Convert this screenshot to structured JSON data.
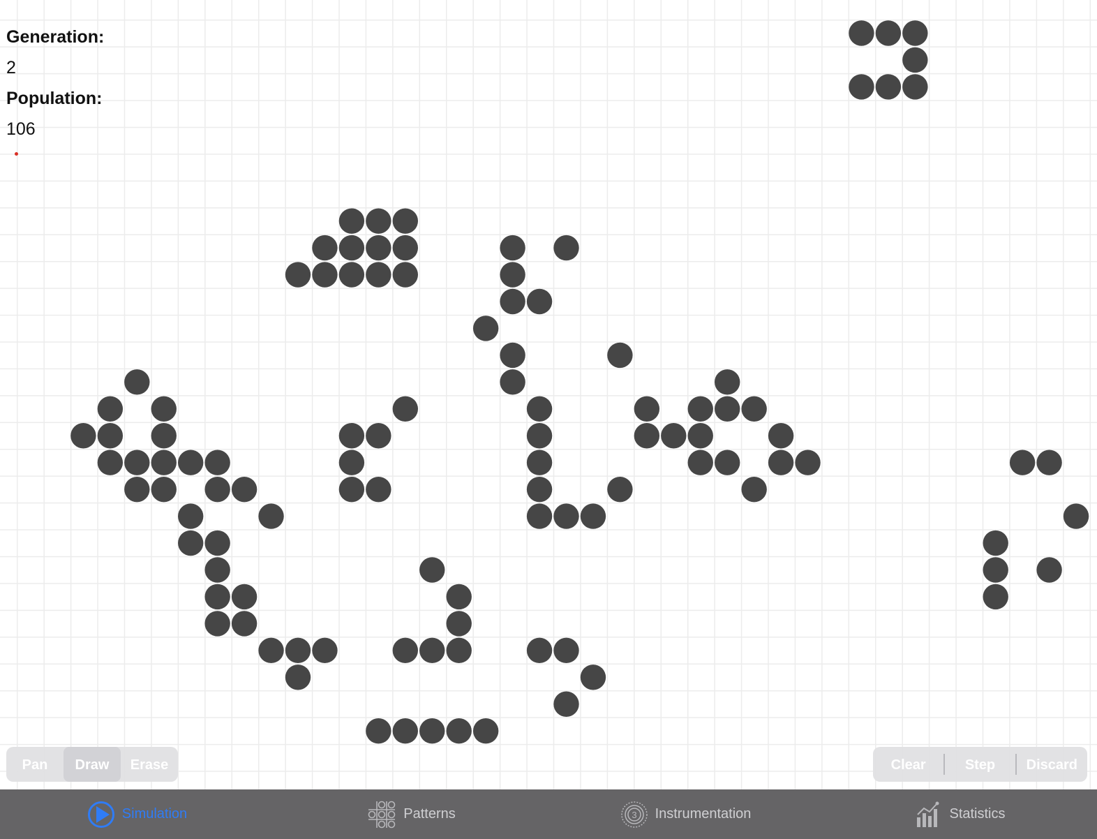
{
  "counters": {
    "generation_label": "Generation:",
    "generation_value": "2",
    "population_label": "Population:",
    "population_value": "106"
  },
  "edit_modes": {
    "pan": "Pan",
    "draw": "Draw",
    "erase": "Erase",
    "selected": "Draw"
  },
  "actions": {
    "clear": "Clear",
    "step": "Step",
    "discard": "Discard"
  },
  "tabs": [
    {
      "label": "Simulation",
      "icon": "play-circle-icon",
      "active": true
    },
    {
      "label": "Patterns",
      "icon": "patterns-grid-icon",
      "active": false
    },
    {
      "label": "Instrumentation",
      "icon": "instrumentation-dial-icon",
      "active": false
    },
    {
      "label": "Statistics",
      "icon": "bar-chart-icon",
      "active": false
    }
  ],
  "colors": {
    "cell": "#464646",
    "grid": "#ececec",
    "tabbar": "#656466",
    "accent": "#2f7cf6",
    "marker": "#d93025"
  },
  "live_cells": [
    [
      31,
      0
    ],
    [
      32,
      0
    ],
    [
      33,
      0
    ],
    [
      33,
      1
    ],
    [
      31,
      2
    ],
    [
      32,
      2
    ],
    [
      33,
      2
    ],
    [
      12,
      7
    ],
    [
      13,
      7
    ],
    [
      14,
      7
    ],
    [
      11,
      8
    ],
    [
      12,
      8
    ],
    [
      13,
      8
    ],
    [
      14,
      8
    ],
    [
      10,
      9
    ],
    [
      11,
      9
    ],
    [
      12,
      9
    ],
    [
      13,
      9
    ],
    [
      14,
      9
    ],
    [
      18,
      8
    ],
    [
      20,
      8
    ],
    [
      18,
      9
    ],
    [
      18,
      10
    ],
    [
      19,
      10
    ],
    [
      17,
      11
    ],
    [
      18,
      12
    ],
    [
      22,
      12
    ],
    [
      18,
      13
    ],
    [
      4,
      13
    ],
    [
      3,
      14
    ],
    [
      5,
      14
    ],
    [
      2,
      15
    ],
    [
      3,
      15
    ],
    [
      5,
      15
    ],
    [
      3,
      16
    ],
    [
      4,
      16
    ],
    [
      5,
      16
    ],
    [
      6,
      16
    ],
    [
      7,
      16
    ],
    [
      4,
      17
    ],
    [
      5,
      17
    ],
    [
      7,
      17
    ],
    [
      8,
      17
    ],
    [
      6,
      18
    ],
    [
      9,
      18
    ],
    [
      6,
      19
    ],
    [
      7,
      19
    ],
    [
      7,
      20
    ],
    [
      7,
      21
    ],
    [
      8,
      21
    ],
    [
      7,
      22
    ],
    [
      8,
      22
    ],
    [
      9,
      23
    ],
    [
      10,
      23
    ],
    [
      11,
      23
    ],
    [
      10,
      24
    ],
    [
      14,
      14
    ],
    [
      12,
      15
    ],
    [
      13,
      15
    ],
    [
      12,
      16
    ],
    [
      12,
      17
    ],
    [
      13,
      17
    ],
    [
      19,
      14
    ],
    [
      19,
      15
    ],
    [
      19,
      16
    ],
    [
      19,
      17
    ],
    [
      19,
      18
    ],
    [
      20,
      18
    ],
    [
      21,
      18
    ],
    [
      22,
      17
    ],
    [
      26,
      13
    ],
    [
      23,
      14
    ],
    [
      25,
      14
    ],
    [
      26,
      14
    ],
    [
      27,
      14
    ],
    [
      23,
      15
    ],
    [
      24,
      15
    ],
    [
      25,
      15
    ],
    [
      28,
      15
    ],
    [
      25,
      16
    ],
    [
      26,
      16
    ],
    [
      28,
      16
    ],
    [
      29,
      16
    ],
    [
      27,
      17
    ],
    [
      37,
      16
    ],
    [
      38,
      16
    ],
    [
      39,
      18
    ],
    [
      36,
      19
    ],
    [
      36,
      20
    ],
    [
      38,
      20
    ],
    [
      36,
      21
    ],
    [
      15,
      20
    ],
    [
      16,
      21
    ],
    [
      16,
      22
    ],
    [
      14,
      23
    ],
    [
      15,
      23
    ],
    [
      16,
      23
    ],
    [
      19,
      23
    ],
    [
      20,
      23
    ],
    [
      21,
      24
    ],
    [
      20,
      25
    ],
    [
      13,
      26
    ],
    [
      14,
      26
    ],
    [
      15,
      26
    ],
    [
      16,
      26
    ],
    [
      17,
      26
    ]
  ]
}
